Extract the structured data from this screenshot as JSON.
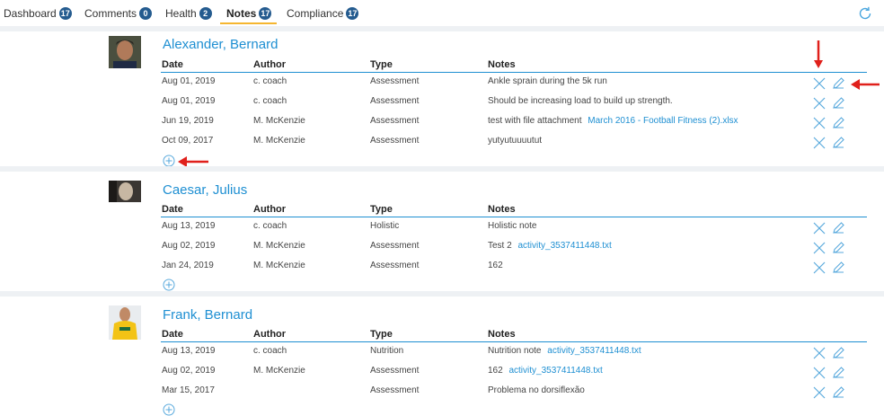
{
  "tabs": [
    {
      "label": "Dashboard",
      "count": "17"
    },
    {
      "label": "Comments",
      "count": "0"
    },
    {
      "label": "Health",
      "count": "2"
    },
    {
      "label": "Notes",
      "count": "17"
    },
    {
      "label": "Compliance",
      "count": "17"
    }
  ],
  "active_tab": "Notes",
  "columns": [
    "Date",
    "Author",
    "Type",
    "Notes"
  ],
  "athletes": [
    {
      "name": "Alexander, Bernard",
      "notes": [
        {
          "date": "Aug 01, 2019",
          "author": "c. coach",
          "type": "Assessment",
          "text": "Ankle sprain during the 5k run",
          "attachment": ""
        },
        {
          "date": "Aug 01, 2019",
          "author": "c. coach",
          "type": "Assessment",
          "text": "Should be increasing load to build up strength.",
          "attachment": ""
        },
        {
          "date": "Jun 19, 2019",
          "author": "M. McKenzie",
          "type": "Assessment",
          "text": "test with file attachment",
          "attachment": "March 2016 - Football Fitness (2).xlsx"
        },
        {
          "date": "Oct 09, 2017",
          "author": "M. McKenzie",
          "type": "Assessment",
          "text": "yutyutuuuutut",
          "attachment": ""
        }
      ]
    },
    {
      "name": "Caesar, Julius",
      "notes": [
        {
          "date": "Aug 13, 2019",
          "author": "c. coach",
          "type": "Holistic",
          "text": "Holistic note",
          "attachment": ""
        },
        {
          "date": "Aug 02, 2019",
          "author": "M. McKenzie",
          "type": "Assessment",
          "text": "Test 2",
          "attachment": "activity_3537411448.txt"
        },
        {
          "date": "Jan 24, 2019",
          "author": "M. McKenzie",
          "type": "Assessment",
          "text": "162",
          "attachment": ""
        }
      ]
    },
    {
      "name": "Frank, Bernard",
      "notes": [
        {
          "date": "Aug 13, 2019",
          "author": "c. coach",
          "type": "Nutrition",
          "text": "Nutrition note",
          "attachment": "activity_3537411448.txt"
        },
        {
          "date": "Aug 02, 2019",
          "author": "M. McKenzie",
          "type": "Assessment",
          "text": "162",
          "attachment": "activity_3537411448.txt"
        },
        {
          "date": "Mar 15, 2017",
          "author": "",
          "type": "Assessment",
          "text": "Problema no dorsiflexão",
          "attachment": ""
        }
      ]
    }
  ],
  "colors": {
    "accent": "#1e8fd2",
    "badge": "#245b8f",
    "tab_underline": "#f5b630",
    "annotation_arrow": "#e0201b"
  },
  "icons": {
    "delete": "close-icon",
    "edit": "pencil-icon",
    "add": "plus-circle-icon",
    "refresh": "refresh-icon"
  }
}
